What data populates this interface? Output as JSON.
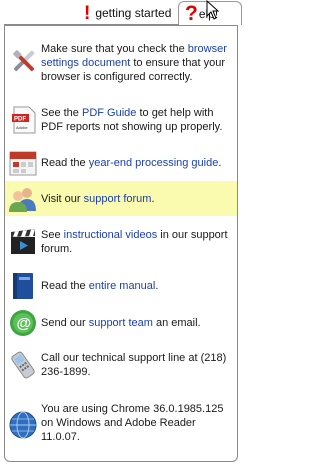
{
  "tabs": {
    "getting_started": "getting started",
    "help": "elp!",
    "help_mark": "?",
    "started_mark": "!"
  },
  "items": [
    {
      "icon": "tools-icon",
      "pre": "Make sure that you check the ",
      "link": "browser settings document",
      "post": " to ensure that your browser is configured correctly."
    },
    {
      "icon": "pdf-document-icon",
      "pre": "See the ",
      "link": "PDF Guide",
      "post": " to get help with PDF reports not showing up properly."
    },
    {
      "icon": "calendar-icon",
      "pre": "Read the ",
      "link": "year-end processing guide",
      "post": "."
    },
    {
      "icon": "users-icon",
      "pre": "Visit our ",
      "link": "support forum",
      "post": "."
    },
    {
      "icon": "video-clapper-icon",
      "pre": "See ",
      "link": "instructional videos",
      "post": " in our support forum."
    },
    {
      "icon": "manual-book-icon",
      "pre": "Read the ",
      "link": "entire manual",
      "post": "."
    },
    {
      "icon": "email-at-icon",
      "pre": "Send our ",
      "link": "support team",
      "post": " an email."
    },
    {
      "icon": "phone-icon",
      "pre": "Call our technical support line at (218) 236-1899.",
      "link": "",
      "post": ""
    },
    {
      "icon": "globe-icon",
      "pre": "You are using Chrome 36.0.1985.125 on Windows and Adobe Reader 11.0.07.",
      "link": "",
      "post": ""
    }
  ],
  "colors": {
    "link": "#1a3fb0",
    "highlight": "#fbfbb0",
    "accent_red": "#e00000"
  }
}
